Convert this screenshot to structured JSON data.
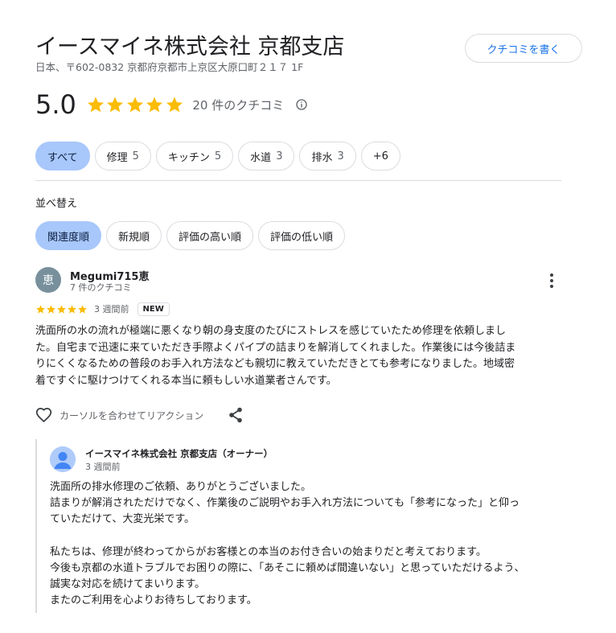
{
  "business": {
    "name": "イースマイネ株式会社 京都支店",
    "address": "日本、〒602-0832 京都府京都市上京区大原口町２１７ 1F",
    "write_review_label": "クチコミを書く"
  },
  "rating": {
    "value": "5.0",
    "stars": 5,
    "count_text": "20 件のクチコミ",
    "star_color": "#fbbc04"
  },
  "filters": [
    {
      "label": "すべて",
      "count": ""
    },
    {
      "label": "修理",
      "count": "5"
    },
    {
      "label": "キッチン",
      "count": "5"
    },
    {
      "label": "水道",
      "count": "3"
    },
    {
      "label": "排水",
      "count": "3"
    },
    {
      "label": "+6",
      "count": ""
    }
  ],
  "sort": {
    "label": "並べ替え",
    "options": [
      "関連度順",
      "新規順",
      "評価の高い順",
      "評価の低い順"
    ]
  },
  "review": {
    "avatar_initial": "恵",
    "reviewer_name": "Megumi715恵",
    "reviewer_meta": "7 件のクチコミ",
    "stars": 5,
    "date": "3 週間前",
    "badge": "NEW",
    "text_lines": [
      "洗面所の水の流れが極端に悪くなり朝の身支度のたびにストレスを感じていたため修理を依頼しまし",
      "た。自宅まで迅速に来ていただき手際よくパイプの詰まりを解消してくれました。作業後には今後詰ま",
      "りにくくなるための普段のお手入れ方法なども親切に教えていただきとても参考になりました。地域密",
      "着ですぐに駆けつけてくれる本当に頼もしい水道業者さんです。"
    ],
    "reaction_label": "カーソルを合わせてリアクション"
  },
  "owner_reply": {
    "name": "イースマイネ株式会社 京都支店（オーナー）",
    "date": "3 週間前",
    "lines": [
      "洗面所の排水修理のご依頼、ありがとうございました。",
      "詰まりが解消されただけでなく、作業後のご説明やお手入れ方法についても「参考になった」と仰っ",
      "ていただけて、大変光栄です。",
      "",
      "私たちは、修理が終わってからがお客様との本当のお付き合いの始まりだと考えております。",
      "今後も京都の水道トラブルでお困りの際に、「あそこに頼めば間違いない」と思っていただけるよう、",
      "誠実な対応を続けてまいります。",
      "またのご利用を心よりお待ちしております。"
    ]
  },
  "icons": {
    "info": "info-icon",
    "more": "more-vert-icon",
    "heart": "heart-outline-icon",
    "share": "share-icon",
    "owner_avatar": "default-user-icon"
  }
}
